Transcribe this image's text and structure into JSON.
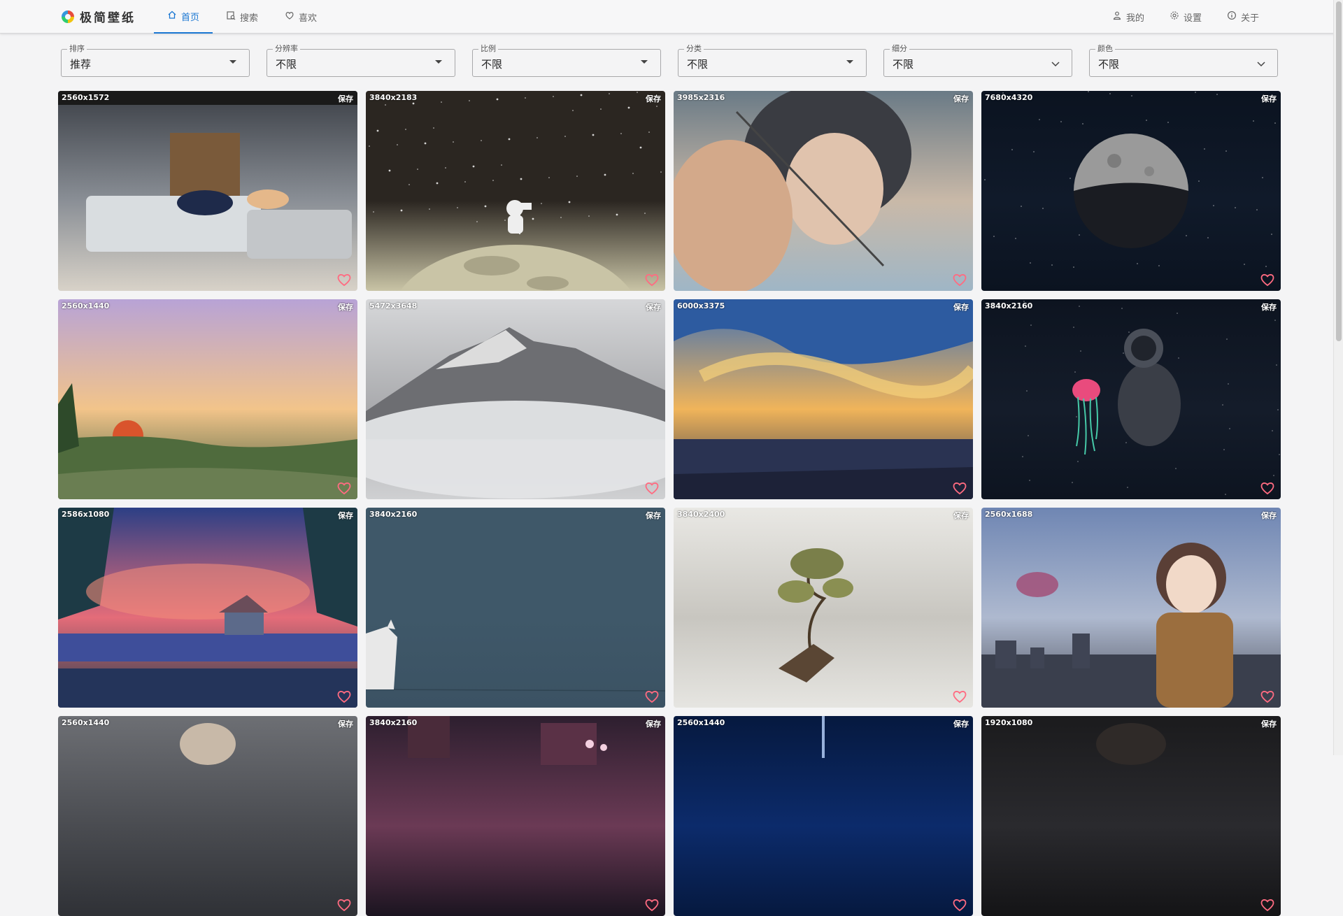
{
  "app": {
    "logo_text": "极简壁纸"
  },
  "nav": {
    "left": [
      {
        "label": "首页",
        "icon": "home-icon",
        "active": true
      },
      {
        "label": "搜索",
        "icon": "search-image-icon",
        "active": false
      },
      {
        "label": "喜欢",
        "icon": "heart-outline-icon",
        "active": false
      }
    ],
    "right": [
      {
        "label": "我的",
        "icon": "user-icon"
      },
      {
        "label": "设置",
        "icon": "gear-icon"
      },
      {
        "label": "关于",
        "icon": "info-icon"
      }
    ]
  },
  "filters": [
    {
      "label": "排序",
      "value": "推荐",
      "caret": "triangle"
    },
    {
      "label": "分辨率",
      "value": "不限",
      "caret": "triangle"
    },
    {
      "label": "比例",
      "value": "不限",
      "caret": "triangle"
    },
    {
      "label": "分类",
      "value": "不限",
      "caret": "triangle"
    },
    {
      "label": "细分",
      "value": "不限",
      "caret": "chevron"
    },
    {
      "label": "颜色",
      "value": "不限",
      "caret": "chevron"
    }
  ],
  "card_save_label": "保存",
  "wallpapers": [
    {
      "resolution": "2560x1572",
      "theme": "anime-room",
      "colors": [
        "#3b3f46",
        "#8a8f96",
        "#d8d2c8"
      ]
    },
    {
      "resolution": "3840x2183",
      "theme": "astronaut-moon",
      "colors": [
        "#2b2621",
        "#2b2621",
        "#c9c4a6"
      ]
    },
    {
      "resolution": "3985x2316",
      "theme": "archer-girl",
      "colors": [
        "#6a7a86",
        "#c9b9a8",
        "#9fb6c6"
      ]
    },
    {
      "resolution": "7680x4320",
      "theme": "moon-night",
      "colors": [
        "#0b1320",
        "#101a2a",
        "#0b1320"
      ]
    },
    {
      "resolution": "2560x1440",
      "theme": "painted-sunset",
      "colors": [
        "#b8a3d6",
        "#f2c48a",
        "#3e5a3a"
      ]
    },
    {
      "resolution": "5472x3648",
      "theme": "foggy-mountain",
      "colors": [
        "#d6d7d9",
        "#a9aaad",
        "#cfd0d2"
      ]
    },
    {
      "resolution": "6000x3375",
      "theme": "sky-sea",
      "colors": [
        "#3f6fb3",
        "#f0b45a",
        "#27304d"
      ]
    },
    {
      "resolution": "3840x2160",
      "theme": "astronaut-jellyfish",
      "colors": [
        "#0d1420",
        "#141c2a",
        "#0d1420"
      ]
    },
    {
      "resolution": "2586x1080",
      "theme": "lake-house",
      "colors": [
        "#2c3f85",
        "#e46c79",
        "#1e3b4a"
      ]
    },
    {
      "resolution": "3840x2160",
      "theme": "cat-minimal",
      "colors": [
        "#3f5869",
        "#3f5869",
        "#3b5263"
      ]
    },
    {
      "resolution": "3840x2400",
      "theme": "floating-tree",
      "colors": [
        "#e9e8e4",
        "#c8c6c0",
        "#e6e5e1"
      ]
    },
    {
      "resolution": "2560x1688",
      "theme": "anime-girl-city",
      "colors": [
        "#6f86b3",
        "#aeb9cf",
        "#4b4e5a"
      ]
    },
    {
      "resolution": "2560x1440",
      "theme": "partial-1",
      "colors": [
        "#6d6f74",
        "#4a4c51",
        "#2f3136"
      ]
    },
    {
      "resolution": "3840x2160",
      "theme": "partial-2",
      "colors": [
        "#2d1f2f",
        "#6b3a55",
        "#1b1420"
      ]
    },
    {
      "resolution": "2560x1440",
      "theme": "partial-3",
      "colors": [
        "#06193f",
        "#0c2b6b",
        "#06193f"
      ]
    },
    {
      "resolution": "1920x1080",
      "theme": "partial-4",
      "colors": [
        "#1b1b1d",
        "#2a2a2e",
        "#141416"
      ]
    }
  ]
}
